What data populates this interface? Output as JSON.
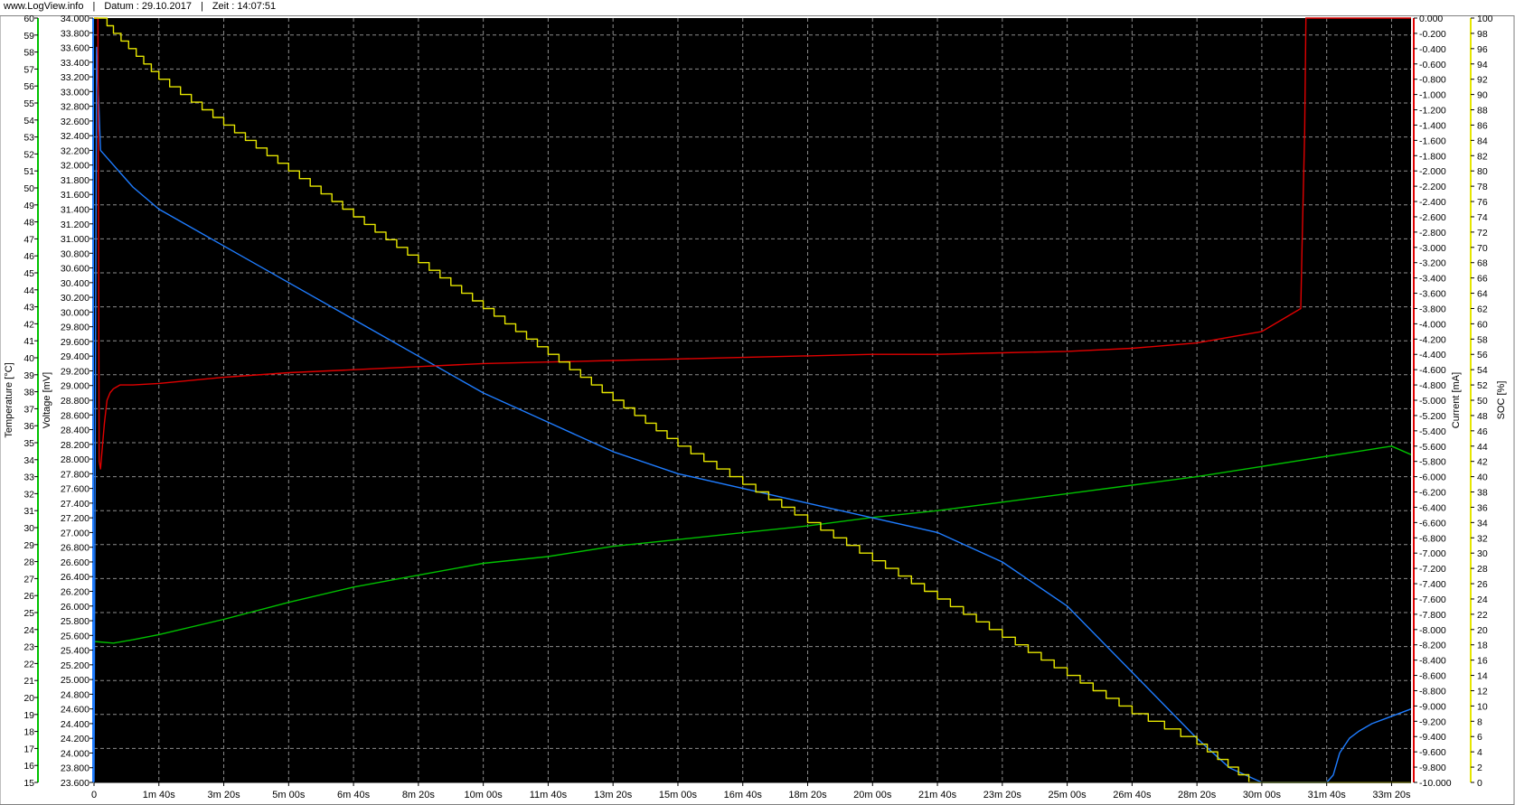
{
  "header": {
    "site": "www.LogView.info",
    "date": "Datum : 29.10.2017",
    "time": "Zeit : 14:07:51"
  },
  "colors": {
    "background": "#000000",
    "grid": "#8c8c8c",
    "temperature": "#00c000",
    "voltage": "#1e7cff",
    "current": "#e00000",
    "soc": "#e6e600"
  },
  "chart_data": {
    "type": "line",
    "grid": true,
    "x": {
      "range_s": [
        0,
        2030
      ],
      "tick_values_s": [
        0,
        100,
        200,
        300,
        400,
        500,
        600,
        700,
        800,
        900,
        1000,
        1100,
        1200,
        1300,
        1400,
        1500,
        1600,
        1700,
        1800,
        1900,
        2000
      ],
      "tick_labels": [
        "0",
        "1m 40s",
        "3m 20s",
        "5m 00s",
        "6m 40s",
        "8m 20s",
        "10m 00s",
        "11m 40s",
        "13m 20s",
        "15m 00s",
        "16m 40s",
        "18m 20s",
        "20m 00s",
        "21m 40s",
        "23m 20s",
        "25m 00s",
        "26m 40s",
        "28m 20s",
        "30m 00s",
        "31m 40s",
        "33m 20s"
      ]
    },
    "axes": {
      "temperature": {
        "label": "Temperature [°C]",
        "range": [
          15,
          60
        ],
        "step": 1,
        "decimals": 0,
        "color": "#00c000"
      },
      "voltage": {
        "label": "Voltage [mV]",
        "range": [
          23600,
          34000
        ],
        "step": 200,
        "decimals": 3,
        "color": "#1e7cff"
      },
      "current": {
        "label": "Current [mA]",
        "range": [
          -10000,
          0
        ],
        "step": 200,
        "decimals": 3,
        "color": "#e00000"
      },
      "soc": {
        "label": "SOC [%]",
        "range": [
          0,
          100
        ],
        "step": 2,
        "decimals": 0,
        "color": "#e6e600"
      }
    },
    "series": [
      {
        "axis": "temperature",
        "color": "#00c000",
        "step": false,
        "x": [
          0,
          30,
          60,
          100,
          200,
          300,
          400,
          500,
          600,
          700,
          800,
          900,
          1000,
          1100,
          1200,
          1300,
          1400,
          1500,
          1600,
          1700,
          1800,
          1900,
          1950,
          2000,
          2030
        ],
        "y": [
          23.3,
          23.2,
          23.4,
          23.7,
          24.6,
          25.6,
          26.5,
          27.2,
          27.9,
          28.3,
          28.9,
          29.3,
          29.7,
          30.1,
          30.6,
          31.0,
          31.5,
          32.0,
          32.5,
          33.0,
          33.6,
          34.2,
          34.5,
          34.8,
          34.3
        ]
      },
      {
        "axis": "voltage",
        "color": "#1e7cff",
        "step": false,
        "x": [
          0,
          4,
          10,
          30,
          60,
          100,
          200,
          300,
          400,
          500,
          600,
          700,
          800,
          900,
          1000,
          1100,
          1200,
          1300,
          1400,
          1500,
          1600,
          1700,
          1750,
          1800,
          1850,
          1880,
          1900,
          1910,
          1920,
          1935,
          1950,
          1970,
          2000,
          2030
        ],
        "y": [
          23600,
          33600,
          32200,
          32000,
          31700,
          31400,
          30900,
          30400,
          29900,
          29400,
          28900,
          28500,
          28100,
          27800,
          27600,
          27400,
          27200,
          27000,
          26600,
          26000,
          25100,
          24200,
          23800,
          23600,
          23600,
          23600,
          23600,
          23700,
          24000,
          24200,
          24300,
          24400,
          24500,
          24600
        ]
      },
      {
        "axis": "current",
        "color": "#e00000",
        "step": false,
        "x": [
          0,
          6,
          8,
          10,
          12,
          16,
          20,
          25,
          30,
          40,
          60,
          100,
          200,
          300,
          400,
          500,
          600,
          700,
          800,
          900,
          1000,
          1100,
          1200,
          1300,
          1400,
          1500,
          1600,
          1700,
          1800,
          1860,
          1862,
          1866,
          1868,
          1900,
          1950,
          2000,
          2030
        ],
        "y": [
          0,
          0,
          -5800,
          -5900,
          -5700,
          -5300,
          -5000,
          -4900,
          -4850,
          -4800,
          -4800,
          -4780,
          -4700,
          -4640,
          -4600,
          -4560,
          -4520,
          -4500,
          -4480,
          -4460,
          -4440,
          -4420,
          -4400,
          -4400,
          -4380,
          -4360,
          -4320,
          -4250,
          -4100,
          -3800,
          -3000,
          -1500,
          0,
          0,
          0,
          0,
          0
        ]
      },
      {
        "axis": "soc",
        "color": "#e6e600",
        "step": true,
        "x": [
          0,
          10,
          30,
          100,
          200,
          300,
          400,
          500,
          600,
          700,
          800,
          900,
          1000,
          1100,
          1200,
          1300,
          1400,
          1500,
          1600,
          1700,
          1780,
          1800,
          1900,
          2000,
          2030
        ],
        "y": [
          100,
          100,
          98,
          92,
          86,
          80,
          74,
          68,
          62,
          56,
          50,
          44,
          39,
          34,
          29,
          24,
          19,
          14,
          9,
          5,
          0,
          0,
          0,
          0,
          0
        ]
      }
    ]
  }
}
